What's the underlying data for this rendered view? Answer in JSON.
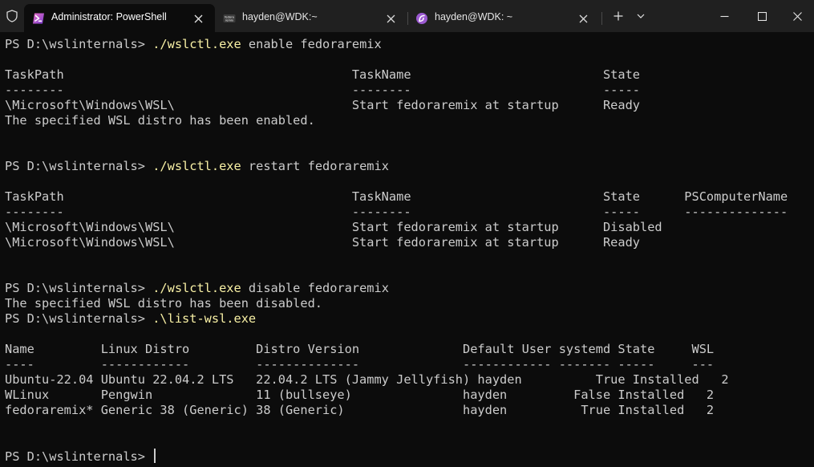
{
  "window": {
    "tabs": [
      {
        "title": "Administrator: PowerShell",
        "active": true,
        "icon": "powershell-icon"
      },
      {
        "title": "hayden@WDK:~",
        "active": false,
        "icon": "fedora-remix-icon"
      },
      {
        "title": "hayden@WDK: ~",
        "active": false,
        "icon": "wsl-distro-icon"
      }
    ],
    "new_tab": "+",
    "dropdown": "⌄",
    "minimize": "—",
    "maximize": "□",
    "close": "✕",
    "tab_close": "✕",
    "colors": {
      "titlebar": "#202020",
      "active_tab": "#0c0c0c",
      "terminal_bg": "#0c0c0c",
      "terminal_fg": "#cccccc",
      "command": "#f9f1a5"
    }
  },
  "terminal": {
    "lines": [
      {
        "prompt": "PS D:\\wslinternals> ",
        "cmd": "./wslctl.exe",
        "args": " enable fedoraremix"
      },
      {
        "text": ""
      },
      {
        "text": "TaskPath                                       TaskName                          State"
      },
      {
        "text": "--------                                       --------                          -----"
      },
      {
        "text": "\\Microsoft\\Windows\\WSL\\                        Start fedoraremix at startup      Ready"
      },
      {
        "text": "The specified WSL distro has been enabled."
      },
      {
        "text": ""
      },
      {
        "text": ""
      },
      {
        "prompt": "PS D:\\wslinternals> ",
        "cmd": "./wslctl.exe",
        "args": " restart fedoraremix"
      },
      {
        "text": ""
      },
      {
        "text": "TaskPath                                       TaskName                          State      PSComputerName"
      },
      {
        "text": "--------                                       --------                          -----      --------------"
      },
      {
        "text": "\\Microsoft\\Windows\\WSL\\                        Start fedoraremix at startup      Disabled"
      },
      {
        "text": "\\Microsoft\\Windows\\WSL\\                        Start fedoraremix at startup      Ready"
      },
      {
        "text": ""
      },
      {
        "text": ""
      },
      {
        "prompt": "PS D:\\wslinternals> ",
        "cmd": "./wslctl.exe",
        "args": " disable fedoraremix"
      },
      {
        "text": "The specified WSL distro has been disabled."
      },
      {
        "prompt": "PS D:\\wslinternals> ",
        "cmd": ".\\list-wsl.exe",
        "args": ""
      },
      {
        "text": ""
      },
      {
        "text": "Name         Linux Distro         Distro Version              Default User systemd State     WSL"
      },
      {
        "text": "----         ------------         --------------              ------------ ------- -----     ---"
      },
      {
        "text": "Ubuntu-22.04 Ubuntu 22.04.2 LTS   22.04.2 LTS (Jammy Jellyfish) hayden          True Installed   2"
      },
      {
        "text": "WLinux       Pengwin              11 (bullseye)               hayden         False Installed   2"
      },
      {
        "text": "fedoraremix* Generic 38 (Generic) 38 (Generic)                hayden          True Installed   2"
      },
      {
        "text": ""
      },
      {
        "text": ""
      },
      {
        "prompt": "PS D:\\wslinternals> ",
        "cursor": true
      }
    ]
  }
}
